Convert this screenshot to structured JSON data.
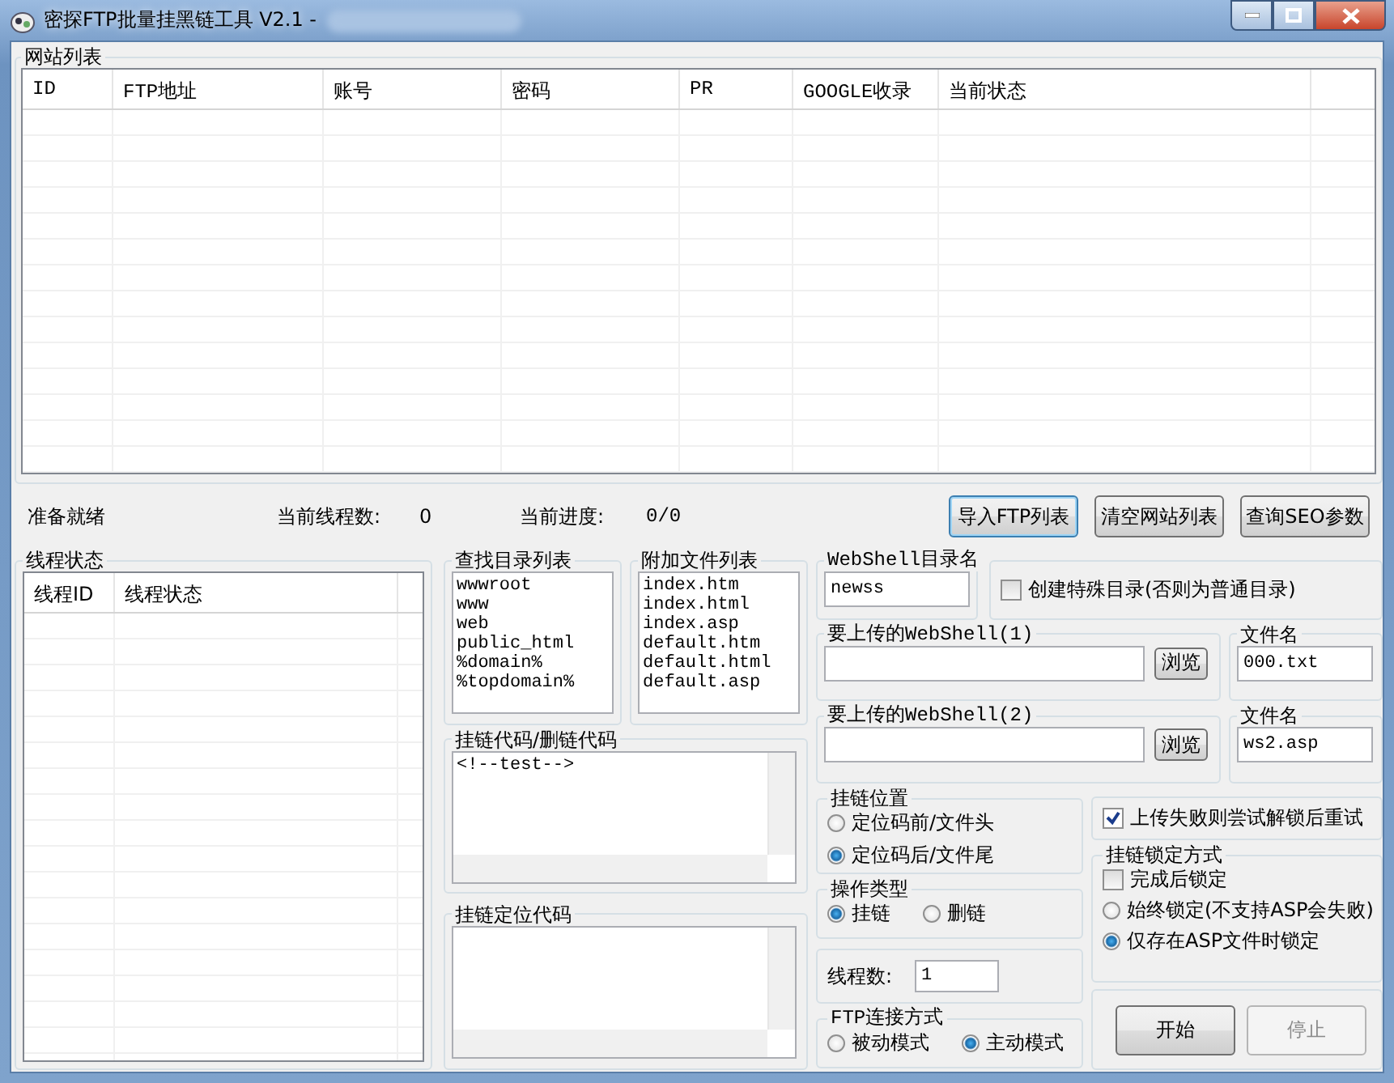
{
  "window": {
    "title": "密探FTP批量挂黑链工具 V2.1 -"
  },
  "site_list": {
    "legend": "网站列表",
    "columns": [
      "ID",
      "FTP地址",
      "账号",
      "密码",
      "PR",
      "GOOGLE收录",
      "当前状态"
    ]
  },
  "status": {
    "ready": "准备就绪",
    "threads_label": "当前线程数:",
    "threads_value": "0",
    "progress_label": "当前进度:",
    "progress_value": "0/0"
  },
  "top_buttons": [
    "导入FTP列表",
    "清空网站列表",
    "查询SEO参数"
  ],
  "thread_status": {
    "legend": "线程状态",
    "columns": [
      "线程ID",
      "线程状态"
    ]
  },
  "search_dirs": {
    "legend": "查找目录列表",
    "items": [
      "wwwroot",
      "www",
      "web",
      "public_html",
      "%domain%",
      "%topdomain%"
    ]
  },
  "extra_files": {
    "legend": "附加文件列表",
    "items": [
      "index.htm",
      "index.html",
      "index.asp",
      "default.htm",
      "default.html",
      "default.asp"
    ]
  },
  "link_code": {
    "legend": "挂链代码/删链代码",
    "value": "<!--test-->"
  },
  "locate_code": {
    "legend": "挂链定位代码"
  },
  "webshell_dir": {
    "legend": "WebShell目录名",
    "value": "newss"
  },
  "special_dir": {
    "label": "创建特殊目录(否则为普通目录)",
    "checked": false
  },
  "uploads": [
    {
      "legend": "要上传的WebShell(1)",
      "browse": "浏览",
      "filename_legend": "文件名",
      "filename": "000.txt"
    },
    {
      "legend": "要上传的WebShell(2)",
      "browse": "浏览",
      "filename_legend": "文件名",
      "filename": "ws2.asp"
    }
  ],
  "link_position": {
    "legend": "挂链位置",
    "options": [
      {
        "label": "定位码前/文件头",
        "selected": false
      },
      {
        "label": "定位码后/文件尾",
        "selected": true
      }
    ]
  },
  "op_type": {
    "legend": "操作类型",
    "options": [
      {
        "label": "挂链",
        "selected": true
      },
      {
        "label": "删链",
        "selected": false
      }
    ]
  },
  "thread_count": {
    "label": "线程数:",
    "value": "1"
  },
  "ftp_mode": {
    "legend": "FTP连接方式",
    "options": [
      {
        "label": "被动模式",
        "selected": false
      },
      {
        "label": "主动模式",
        "selected": true
      }
    ]
  },
  "retry_unlock": {
    "label": "上传失败则尝试解锁后重试",
    "checked": true
  },
  "lock_mode": {
    "legend": "挂链锁定方式",
    "items": [
      {
        "kind": "checkbox",
        "label": "完成后锁定",
        "checked": false
      },
      {
        "kind": "radio",
        "label": "始终锁定(不支持ASP会失败)",
        "selected": false
      },
      {
        "kind": "radio",
        "label": "仅存在ASP文件时锁定",
        "selected": true
      }
    ]
  },
  "actions": [
    {
      "label": "开始",
      "disabled": false
    },
    {
      "label": "停止",
      "disabled": true
    }
  ]
}
